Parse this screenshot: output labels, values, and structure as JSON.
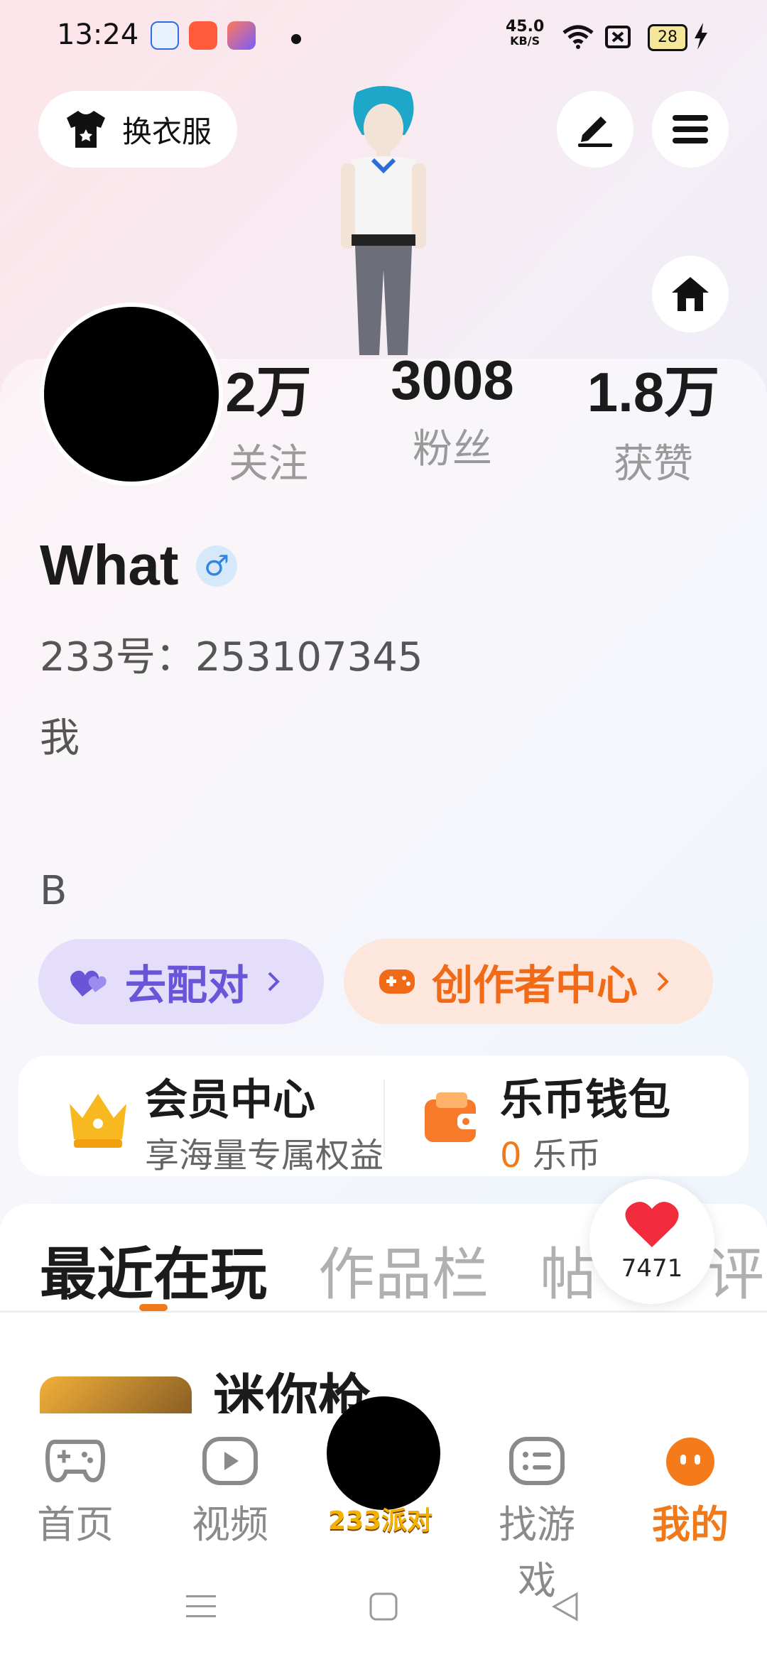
{
  "status_bar": {
    "time": "13:24",
    "net_speed": "45.0",
    "net_unit": "KB/S",
    "battery": "28"
  },
  "top_bar": {
    "dress_up_label": "换衣服"
  },
  "stats": [
    {
      "value": "2万",
      "label": "关注"
    },
    {
      "value": "3008",
      "label": "粉丝"
    },
    {
      "value": "1.8万",
      "label": "获赞"
    }
  ],
  "profile": {
    "username": "What",
    "gender_symbol": "♂",
    "uid": "233号：253107345",
    "bio_line1": "我",
    "bio_line2": "B"
  },
  "actions": {
    "match_label": "去配对",
    "creator_label": "创作者中心"
  },
  "vip": {
    "title": "会员中心",
    "subtitle": "享海量专属权益"
  },
  "wallet": {
    "title": "乐币钱包",
    "amount": "0",
    "unit": "乐币"
  },
  "tabs": [
    "最近在玩",
    "作品栏",
    "帖",
    "评"
  ],
  "likes": {
    "count": "7471"
  },
  "recent_game": {
    "name": "迷你枪"
  },
  "bottom_nav": {
    "home": "首页",
    "video": "视频",
    "center": "233派对",
    "find_games": "找游戏",
    "mine": "我的"
  }
}
